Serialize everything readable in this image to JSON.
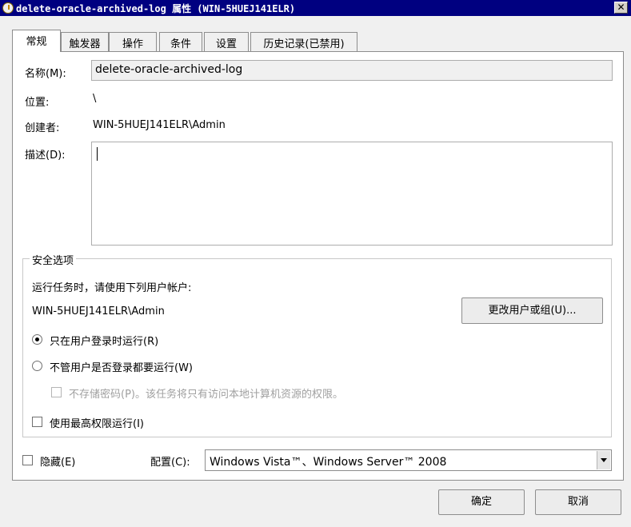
{
  "window": {
    "title": "delete-oracle-archived-log 属性 (WIN-5HUEJ141ELR)",
    "close_glyph": "✕"
  },
  "tabs": [
    {
      "label": "常规",
      "active": true
    },
    {
      "label": "触发器"
    },
    {
      "label": "操作"
    },
    {
      "label": "条件"
    },
    {
      "label": "设置"
    },
    {
      "label": "历史记录(已禁用)"
    }
  ],
  "general": {
    "name_label": "名称(M):",
    "name_value": "delete-oracle-archived-log",
    "location_label": "位置:",
    "location_value": "\\",
    "author_label": "创建者:",
    "author_value": "WIN-5HUEJ141ELR\\Admin",
    "description_label": "描述(D):",
    "description_value": ""
  },
  "security": {
    "legend": "安全选项",
    "run_as_prompt": "运行任务时，请使用下列用户帐户:",
    "user_account": "WIN-5HUEJ141ELR\\Admin",
    "change_user_button": "更改用户或组(U)...",
    "radio_logged_on": "只在用户登录时运行(R)",
    "radio_logged_on_checked": true,
    "radio_whether_logged_on": "不管用户是否登录都要运行(W)",
    "checkbox_no_store_password": "不存储密码(P)。该任务将只有访问本地计算机资源的权限。",
    "checkbox_highest_privileges": "使用最高权限运行(I)"
  },
  "bottom": {
    "hidden_label": "隐藏(E)",
    "configure_label": "配置(C):",
    "configure_value": "Windows Vista™、Windows Server™ 2008"
  },
  "buttons": {
    "ok": "确定",
    "cancel": "取消"
  }
}
